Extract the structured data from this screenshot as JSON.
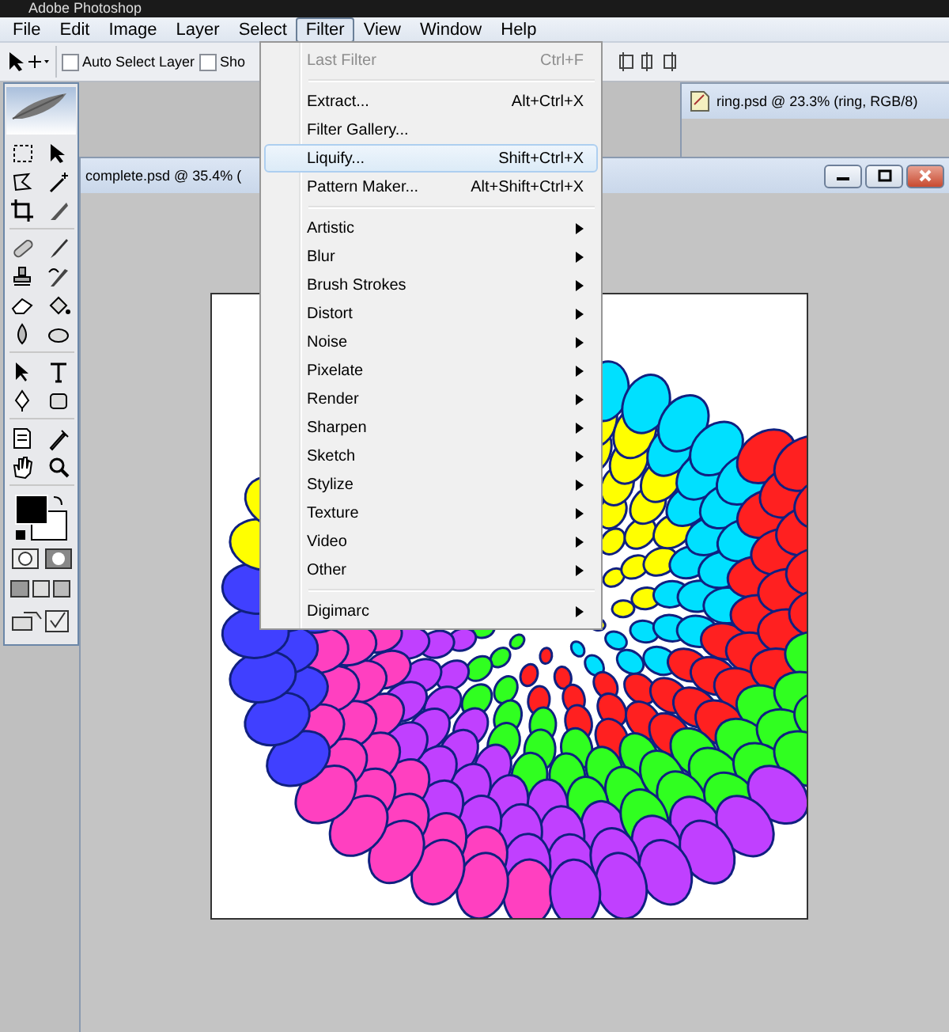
{
  "window": {
    "title": "Adobe Photoshop"
  },
  "menu_bar": [
    {
      "label": "File",
      "selected": false
    },
    {
      "label": "Edit",
      "selected": false
    },
    {
      "label": "Image",
      "selected": false
    },
    {
      "label": "Layer",
      "selected": false
    },
    {
      "label": "Select",
      "selected": false
    },
    {
      "label": "Filter",
      "selected": true
    },
    {
      "label": "View",
      "selected": false
    },
    {
      "label": "Window",
      "selected": false
    },
    {
      "label": "Help",
      "selected": false
    }
  ],
  "options_bar": {
    "checkboxes": [
      {
        "label": "Auto Select Layer",
        "checked": false
      },
      {
        "label": "Sho",
        "checked": false
      }
    ]
  },
  "documents": [
    {
      "title": "ring.psd @ 23.3% (ring, RGB/8)"
    },
    {
      "title": "complete.psd @ 35.4% ("
    }
  ],
  "filter_menu": {
    "items": [
      {
        "kind": "item",
        "label": "Last Filter",
        "shortcut": "Ctrl+F",
        "disabled": true,
        "selected": false
      },
      {
        "kind": "separator"
      },
      {
        "kind": "item",
        "label": "Extract...",
        "shortcut": "Alt+Ctrl+X",
        "disabled": false,
        "selected": false
      },
      {
        "kind": "item",
        "label": "Filter Gallery...",
        "disabled": false,
        "selected": false
      },
      {
        "kind": "item",
        "label": "Liquify...",
        "shortcut": "Shift+Ctrl+X",
        "disabled": false,
        "selected": true
      },
      {
        "kind": "item",
        "label": "Pattern Maker...",
        "shortcut": "Alt+Shift+Ctrl+X",
        "disabled": false,
        "selected": false
      },
      {
        "kind": "separator"
      },
      {
        "kind": "submenu",
        "label": "Artistic",
        "disabled": false,
        "selected": false
      },
      {
        "kind": "submenu",
        "label": "Blur",
        "disabled": false,
        "selected": false
      },
      {
        "kind": "submenu",
        "label": "Brush Strokes",
        "disabled": false,
        "selected": false
      },
      {
        "kind": "submenu",
        "label": "Distort",
        "disabled": false,
        "selected": false
      },
      {
        "kind": "submenu",
        "label": "Noise",
        "disabled": false,
        "selected": false
      },
      {
        "kind": "submenu",
        "label": "Pixelate",
        "disabled": false,
        "selected": false
      },
      {
        "kind": "submenu",
        "label": "Render",
        "disabled": false,
        "selected": false
      },
      {
        "kind": "submenu",
        "label": "Sharpen",
        "disabled": false,
        "selected": false
      },
      {
        "kind": "submenu",
        "label": "Sketch",
        "disabled": false,
        "selected": false
      },
      {
        "kind": "submenu",
        "label": "Stylize",
        "disabled": false,
        "selected": false
      },
      {
        "kind": "submenu",
        "label": "Texture",
        "disabled": false,
        "selected": false
      },
      {
        "kind": "submenu",
        "label": "Video",
        "disabled": false,
        "selected": false
      },
      {
        "kind": "submenu",
        "label": "Other",
        "disabled": false,
        "selected": false
      },
      {
        "kind": "separator"
      },
      {
        "kind": "submenu",
        "label": "Digimarc",
        "disabled": false,
        "selected": false
      }
    ]
  }
}
